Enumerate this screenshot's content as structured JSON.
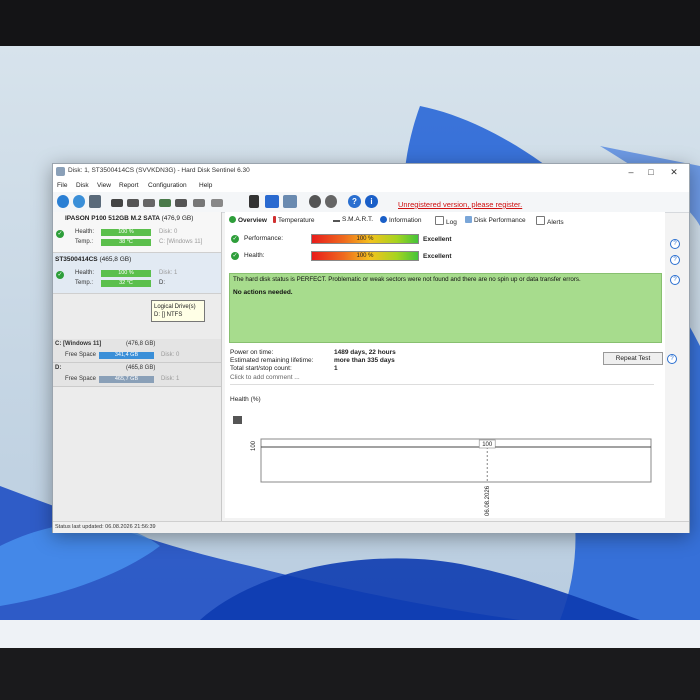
{
  "window": {
    "title": "Disk: 1, ST3500414CS (SVVKDN3G)  -  Hard Disk Sentinel 6.30",
    "controls": [
      "–",
      "□",
      "✕"
    ]
  },
  "menu": [
    "File",
    "Disk",
    "View",
    "Report",
    "Configuration",
    "Help"
  ],
  "toolbar": {
    "unregistered": "Unregistered version, please register."
  },
  "disks": [
    {
      "title": "IPASON P100 512GB M.2 SATA",
      "size": "(476,9 GB)",
      "health_label": "Health:",
      "health_value": "100 %",
      "health_pct": 100,
      "temp_label": "Temp.:",
      "temp_value": "38 °C",
      "disk_index": "Disk: 0",
      "drive": "C: [Windows 11]"
    },
    {
      "title": "ST3500414CS",
      "size": "(465,8 GB)",
      "health_label": "Health:",
      "health_value": "100 %",
      "health_pct": 100,
      "temp_label": "Temp.:",
      "temp_value": "32 °C",
      "disk_index": "Disk: 1",
      "drive": "D:"
    }
  ],
  "tooltip": {
    "line1": "Logical Drive(s)",
    "line2": "D: [] NTFS"
  },
  "volumes": [
    {
      "name": "C: [Windows 11]",
      "size": "(476,8 GB)",
      "free_label": "Free Space",
      "free_value": "341,4 GB",
      "disk": "Disk: 0"
    },
    {
      "name": "D:",
      "size": "(465,8 GB)",
      "free_label": "Free Space",
      "free_value": "465,7 GB",
      "disk": "Disk: 1"
    }
  ],
  "status_bar": "Status last updated: 06.08.2026 21:56:39",
  "tabs": [
    "Overview",
    "Temperature",
    "S.M.A.R.T.",
    "Information",
    "Log",
    "Disk Performance",
    "Alerts"
  ],
  "overview": {
    "performance_label": "Performance:",
    "performance_value": "100 %",
    "performance_rating": "Excellent",
    "health_label": "Health:",
    "health_value": "100 %",
    "health_rating": "Excellent",
    "status_message": "The hard disk status is PERFECT. Problematic or weak sectors were not found and there are no spin up or data transfer errors.",
    "actions": "No actions needed.",
    "power_on_label": "Power on time:",
    "power_on_value": "1489 days, 22 hours",
    "lifetime_label": "Estimated remaining lifetime:",
    "lifetime_value": "more than 335 days",
    "startstop_label": "Total start/stop count:",
    "startstop_value": "1",
    "repeat_test": "Repeat Test",
    "comment_placeholder": "Click to add comment ...",
    "health_chart_label": "Health (%)"
  },
  "chart_data": {
    "type": "line",
    "title": "",
    "xlabel": "",
    "ylabel": "",
    "x": [
      "06.08.2026"
    ],
    "series": [
      {
        "values": [
          100
        ]
      }
    ],
    "y_tick_labels": [
      "100"
    ],
    "data_labels": [
      "100"
    ],
    "ylim": [
      0,
      100
    ],
    "grid": false
  },
  "colors": {
    "healthy_green": "#5bbf4c",
    "status_box": "#a7dc8d",
    "free_space_blue": "#3a8fd8",
    "unregistered_red": "#d01010"
  }
}
